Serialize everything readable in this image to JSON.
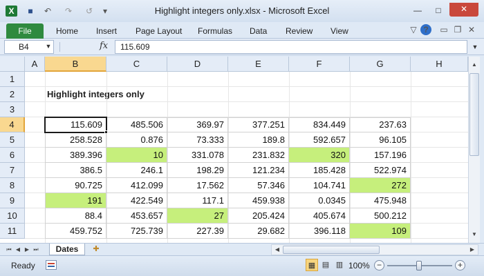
{
  "window": {
    "title": "Highlight integers only.xlsx - Microsoft Excel",
    "app_icon_glyph": "X",
    "controls": {
      "minimize": "—",
      "maximize": "□",
      "close": "✕"
    }
  },
  "quick_access": {
    "save_icon": "■",
    "undo_icon": "↶",
    "redo_icon": "↷",
    "repeat_icon": "↺",
    "customize_icon": "▾"
  },
  "ribbon": {
    "file_tab": "File",
    "tabs": [
      "Home",
      "Insert",
      "Page Layout",
      "Formulas",
      "Data",
      "Review",
      "View"
    ],
    "right_icons": {
      "collapse": "▽",
      "help": "?",
      "min": "▭",
      "restore": "❐",
      "close": "✕"
    }
  },
  "formula_bar": {
    "name_box": "B4",
    "name_box_arrow": "▼",
    "fx_label": "fx",
    "formula_value": "115.609",
    "expand_icon": "▼"
  },
  "sheet": {
    "column_headers": [
      "A",
      "B",
      "C",
      "D",
      "E",
      "F",
      "G",
      "H"
    ],
    "row_headers": [
      "1",
      "2",
      "3",
      "4",
      "5",
      "6",
      "7",
      "8",
      "9",
      "10",
      "11"
    ],
    "selected_column": "B",
    "selected_row": "4",
    "title": "Highlight integers only",
    "highlight_color": "#c6ef7c",
    "data": [
      [
        "115.609",
        "485.506",
        "369.97",
        "377.251",
        "834.449",
        "237.63"
      ],
      [
        "258.528",
        "0.876",
        "73.333",
        "189.8",
        "592.657",
        "96.105"
      ],
      [
        "389.396",
        "10",
        "331.078",
        "231.832",
        "320",
        "157.196"
      ],
      [
        "386.5",
        "246.1",
        "198.29",
        "121.234",
        "185.428",
        "522.974"
      ],
      [
        "90.725",
        "412.099",
        "17.562",
        "57.346",
        "104.741",
        "272"
      ],
      [
        "191",
        "422.549",
        "117.1",
        "459.938",
        "0.0345",
        "475.948"
      ],
      [
        "88.4",
        "453.657",
        "27",
        "205.424",
        "405.674",
        "500.212"
      ],
      [
        "459.752",
        "725.739",
        "227.39",
        "29.682",
        "396.118",
        "109"
      ]
    ],
    "highlighted": [
      [
        false,
        false,
        false,
        false,
        false,
        false
      ],
      [
        false,
        false,
        false,
        false,
        false,
        false
      ],
      [
        false,
        true,
        false,
        false,
        true,
        false
      ],
      [
        false,
        false,
        false,
        false,
        false,
        false
      ],
      [
        false,
        false,
        false,
        false,
        false,
        true
      ],
      [
        true,
        false,
        false,
        false,
        false,
        false
      ],
      [
        false,
        false,
        true,
        false,
        false,
        false
      ],
      [
        false,
        false,
        false,
        false,
        false,
        true
      ]
    ]
  },
  "sheet_tabs": {
    "nav": [
      "⏮",
      "◀",
      "▶",
      "⏭"
    ],
    "tabs": [
      "Dates"
    ],
    "new_sheet_icon": "✚"
  },
  "scrollbars": {
    "up": "▲",
    "down": "▼",
    "left": "◀",
    "right": "▶"
  },
  "status_bar": {
    "status": "Ready",
    "view_normal": "▦",
    "view_layout": "▤",
    "view_break": "▥",
    "zoom": "100%",
    "zoom_out": "−",
    "zoom_in": "+"
  }
}
